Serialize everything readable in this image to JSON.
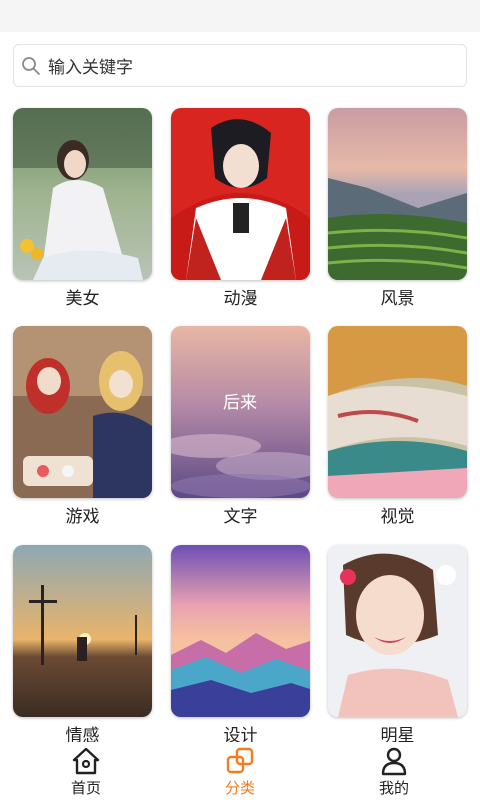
{
  "search": {
    "placeholder": "输入关键字"
  },
  "categories": [
    {
      "label": "美女"
    },
    {
      "label": "动漫"
    },
    {
      "label": "风景"
    },
    {
      "label": "游戏"
    },
    {
      "label": "文字"
    },
    {
      "label": "视觉"
    },
    {
      "label": "情感"
    },
    {
      "label": "设计"
    },
    {
      "label": "明星"
    }
  ],
  "thumb_text": {
    "wenzi": "后来"
  },
  "tabbar": {
    "home": "首页",
    "category": "分类",
    "mine": "我的"
  },
  "colors": {
    "accent": "#f47c20",
    "text": "#222222"
  },
  "icons": {
    "search": "search-icon",
    "home": "home-icon",
    "category": "category-icon",
    "mine": "user-icon"
  }
}
